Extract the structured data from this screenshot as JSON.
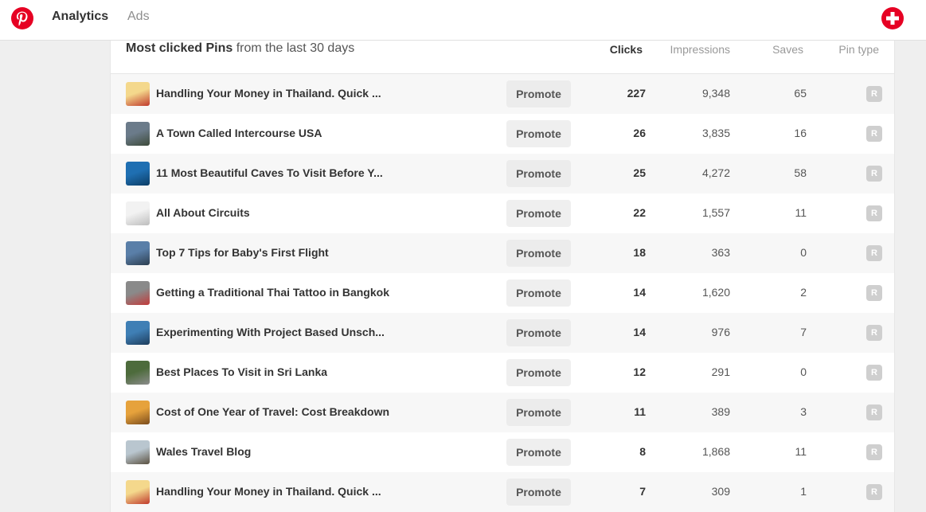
{
  "nav": {
    "analytics": "Analytics",
    "ads": "Ads"
  },
  "section": {
    "title_strong": "Most clicked Pins",
    "title_rest": " from the last 30 days"
  },
  "columns": {
    "clicks": "Clicks",
    "impressions": "Impressions",
    "saves": "Saves",
    "pin_type": "Pin type"
  },
  "promote_label": "Promote",
  "colors": {
    "brand": "#e60023",
    "badge": "#cfcfcf"
  },
  "rows": [
    {
      "title": "Handling Your Money in Thailand. Quick ...",
      "clicks": "227",
      "impressions": "9,348",
      "saves": "65",
      "type": "R",
      "thumb": [
        "#f4d88c",
        "#c0392b"
      ]
    },
    {
      "title": "A Town Called Intercourse USA",
      "clicks": "26",
      "impressions": "3,835",
      "saves": "16",
      "type": "R",
      "thumb": [
        "#6b7b8a",
        "#3d4a3a"
      ]
    },
    {
      "title": "11 Most Beautiful Caves To Visit Before Y...",
      "clicks": "25",
      "impressions": "4,272",
      "saves": "58",
      "type": "R",
      "thumb": [
        "#1f6fb2",
        "#0c3d66"
      ]
    },
    {
      "title": "All About Circuits",
      "clicks": "22",
      "impressions": "1,557",
      "saves": "11",
      "type": "R",
      "thumb": [
        "#f2f2f2",
        "#bdbdbd"
      ]
    },
    {
      "title": "Top 7 Tips for Baby's First Flight",
      "clicks": "18",
      "impressions": "363",
      "saves": "0",
      "type": "R",
      "thumb": [
        "#5a7fa8",
        "#2d3e50"
      ]
    },
    {
      "title": "Getting a Traditional Thai Tattoo in Bangkok",
      "clicks": "14",
      "impressions": "1,620",
      "saves": "2",
      "type": "R",
      "thumb": [
        "#8a8a8a",
        "#c23b3b"
      ]
    },
    {
      "title": "Experimenting With Project Based Unsch...",
      "clicks": "14",
      "impressions": "976",
      "saves": "7",
      "type": "R",
      "thumb": [
        "#3f7fb5",
        "#1e3d5c"
      ]
    },
    {
      "title": "Best Places To Visit in Sri Lanka",
      "clicks": "12",
      "impressions": "291",
      "saves": "0",
      "type": "R",
      "thumb": [
        "#4d6b3c",
        "#8c8c8c"
      ]
    },
    {
      "title": "Cost of One Year of Travel: Cost Breakdown",
      "clicks": "11",
      "impressions": "389",
      "saves": "3",
      "type": "R",
      "thumb": [
        "#e6a23c",
        "#7a4b1c"
      ]
    },
    {
      "title": "Wales Travel Blog",
      "clicks": "8",
      "impressions": "1,868",
      "saves": "11",
      "type": "R",
      "thumb": [
        "#b9c6cf",
        "#5a5040"
      ]
    },
    {
      "title": "Handling Your Money in Thailand. Quick ...",
      "clicks": "7",
      "impressions": "309",
      "saves": "1",
      "type": "R",
      "thumb": [
        "#f4d88c",
        "#c0392b"
      ]
    }
  ]
}
